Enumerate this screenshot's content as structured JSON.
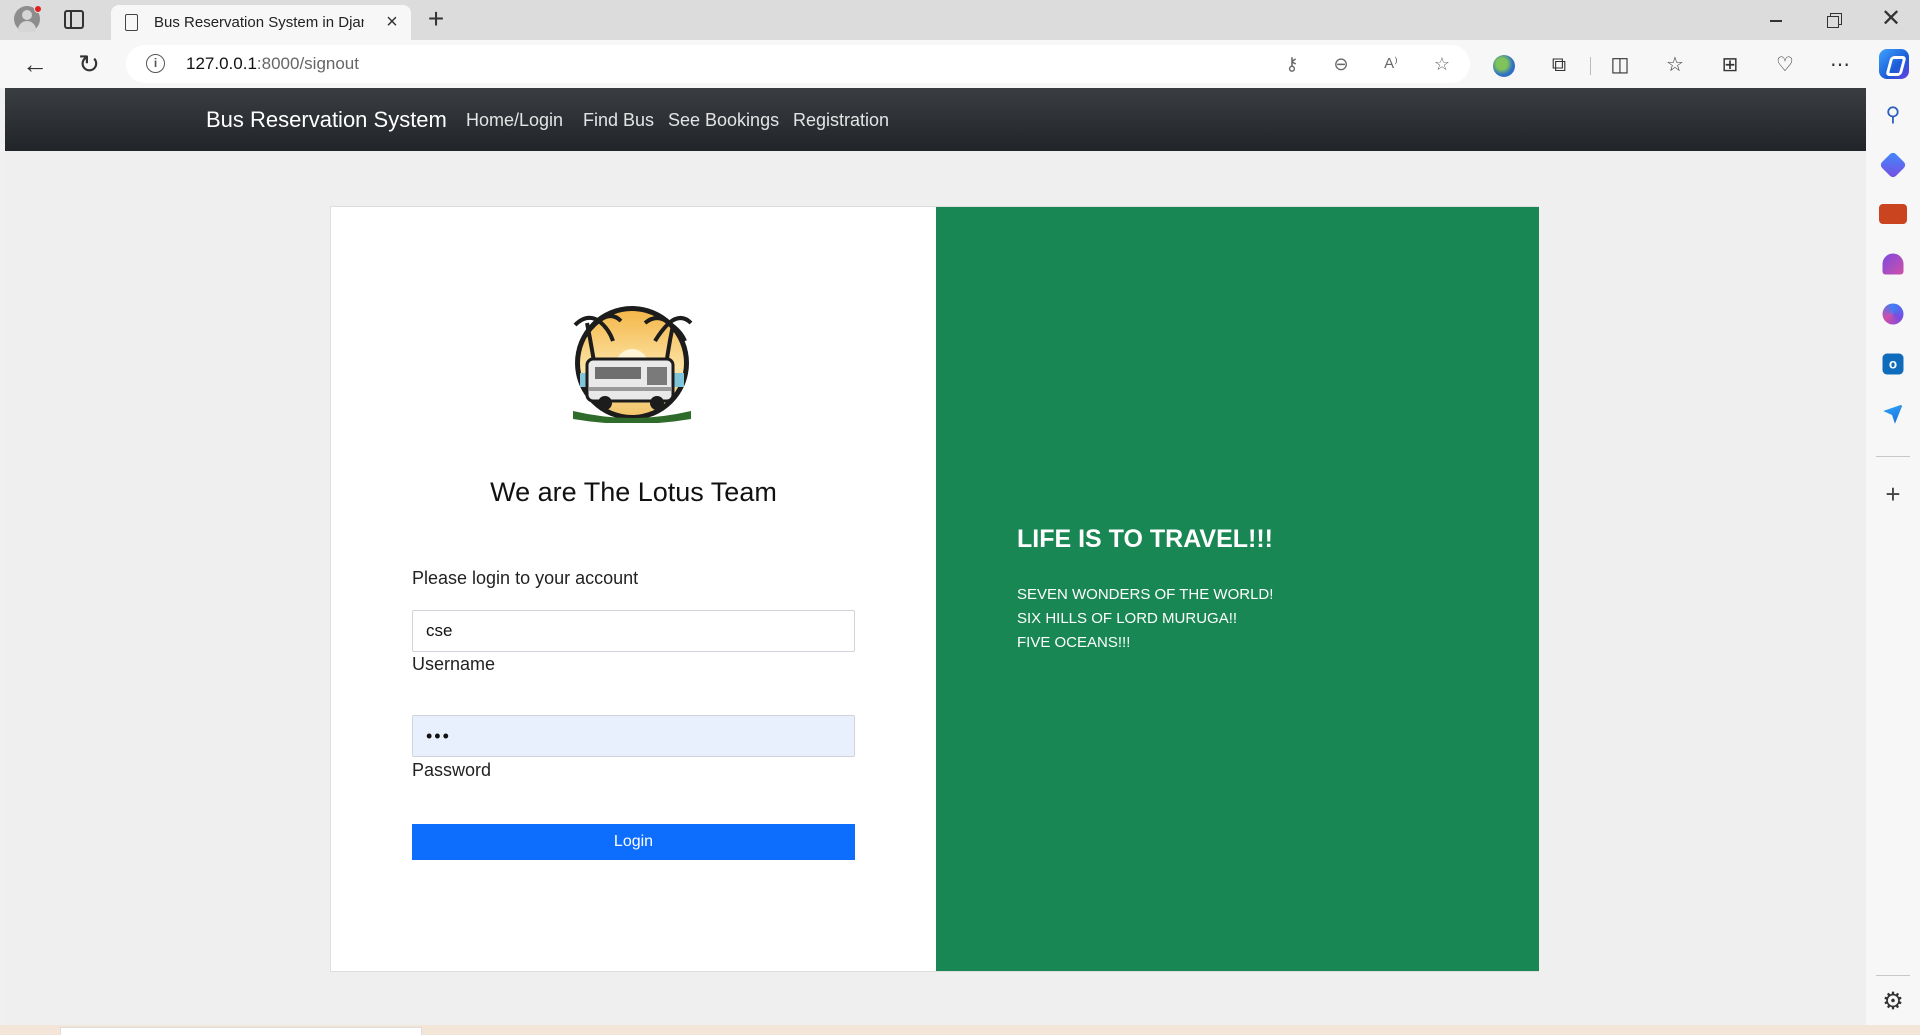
{
  "browser": {
    "tab_title": "Bus Reservation System in Djang",
    "tab_close": "×",
    "new_tab": "+",
    "url_host": "127.0.0.1",
    "url_path": ":8000/signout",
    "info_glyph": "i",
    "window_close": "✕",
    "back_glyph": "←",
    "reload_glyph": "↻",
    "toolbar_icons": [
      "key-icon",
      "zoom-out-icon",
      "read-aloud-icon",
      "favorite-star-icon",
      "extension-globe-icon",
      "extensions-icon",
      "split-screen-icon",
      "favorites-icon",
      "collections-icon",
      "browser-essentials-icon",
      "more-icon",
      "copilot-icon"
    ],
    "sidebar_icons": [
      "search-icon",
      "shopping-tag-icon",
      "tools-briefcase-icon",
      "games-icon",
      "microsoft365-icon",
      "outlook-icon",
      "send-icon",
      "add-icon",
      "settings-gear-icon"
    ]
  },
  "navbar": {
    "brand": "Bus Reservation System",
    "links": [
      "Home/Login",
      "Find Bus",
      "See Bookings",
      "Registration"
    ]
  },
  "login": {
    "logo": "bus-palm-trees-logo",
    "team_title": "We are The Lotus Team",
    "prompt": "Please login to your account",
    "username_value": "cse",
    "username_label": "Username",
    "password_value": "•••",
    "password_label": "Password",
    "login_button": "Login"
  },
  "promo": {
    "heading": "LIFE IS TO TRAVEL!!!",
    "lines": [
      "SEVEN WONDERS OF THE WORLD!",
      "SIX HILLS OF LORD MURUGA!!",
      "FIVE OCEANS!!!"
    ]
  },
  "colors": {
    "navbar": "#212428",
    "promo_panel": "#198754",
    "login_button": "#0d6efd",
    "password_autofill_bg": "#e8f0fe"
  }
}
